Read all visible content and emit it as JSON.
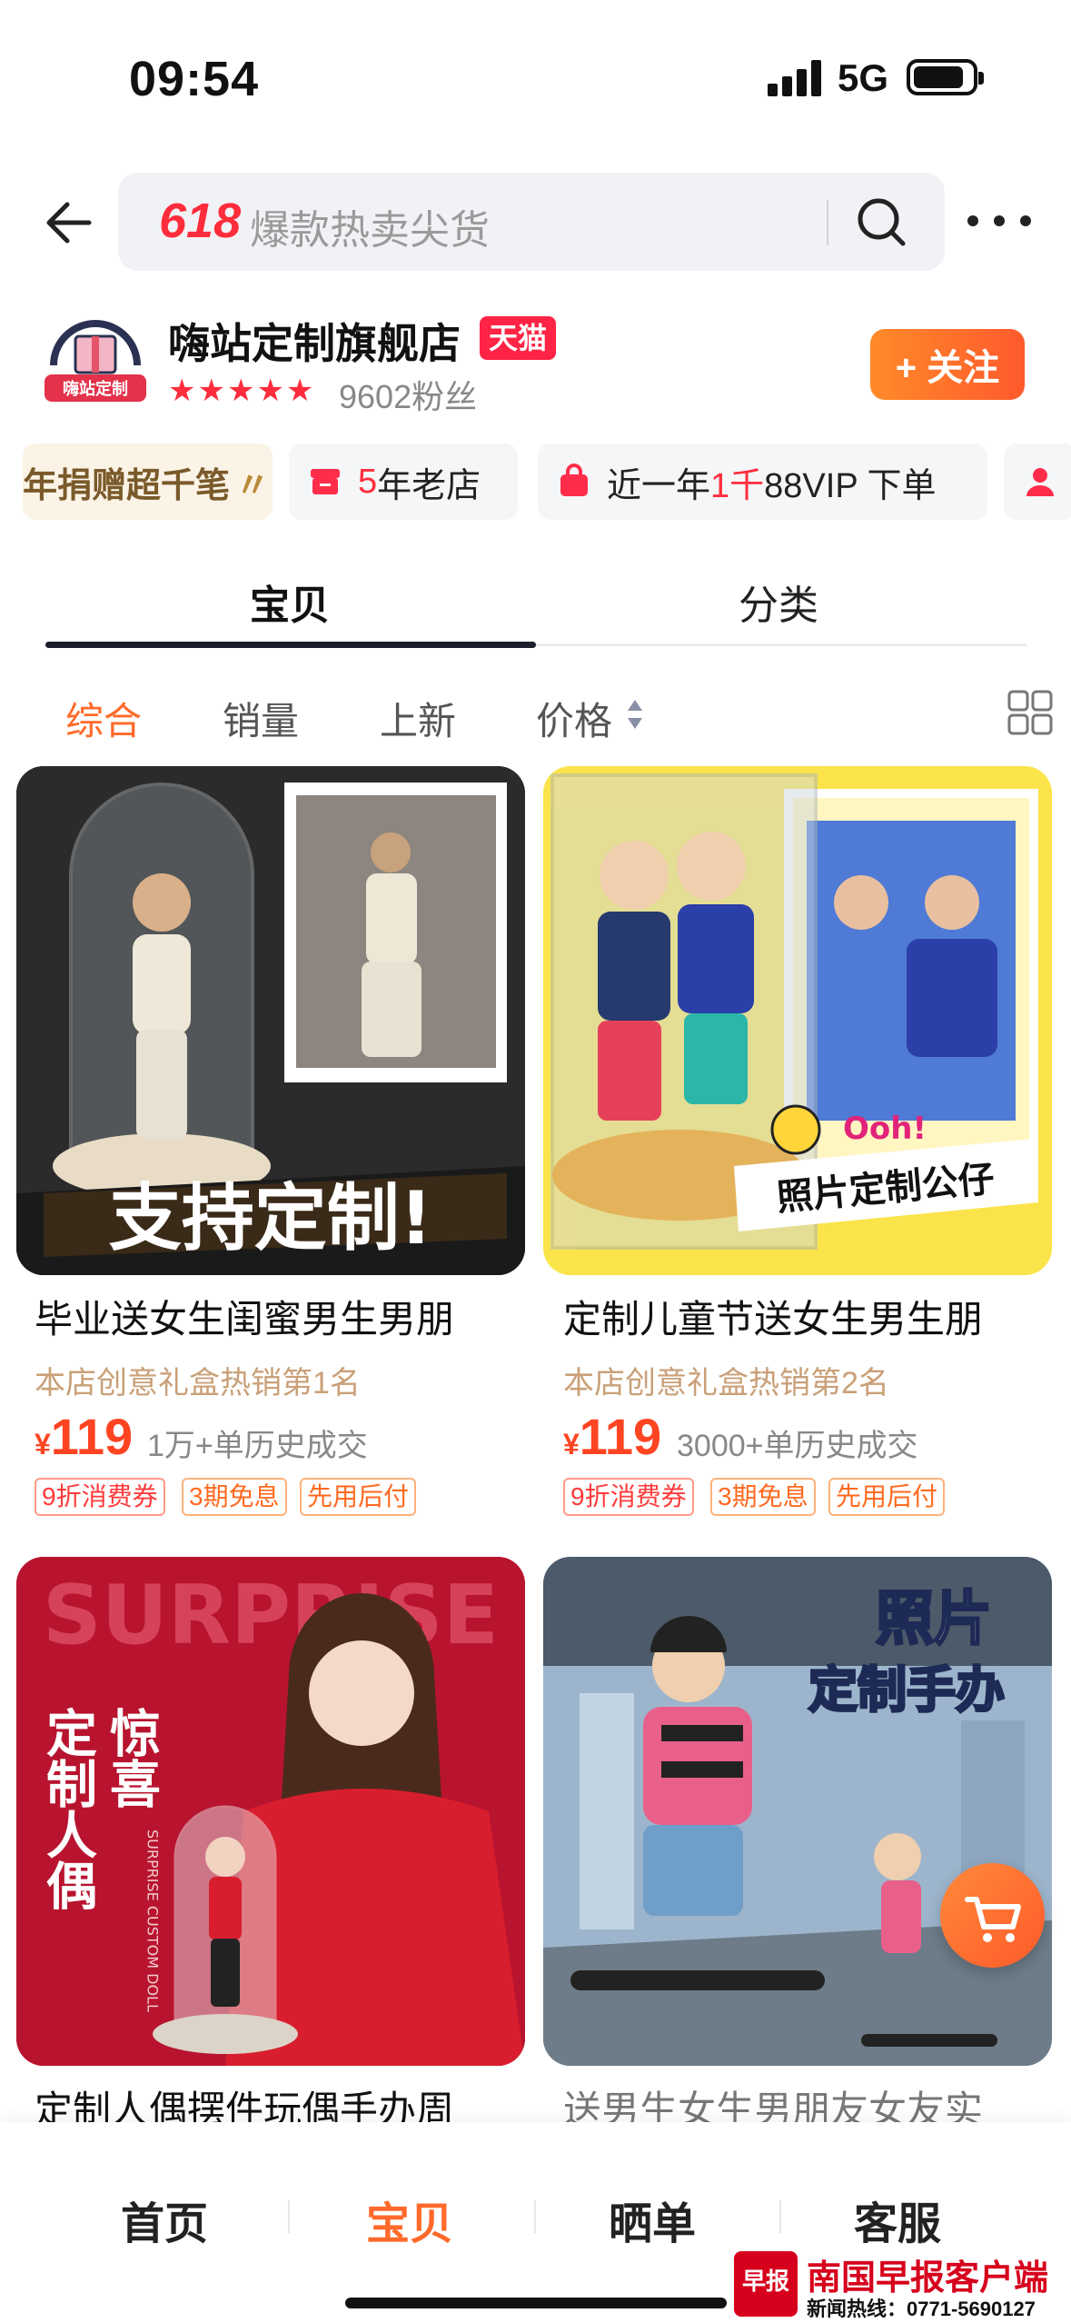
{
  "status_bar": {
    "time": "09:54",
    "network": "5G"
  },
  "search": {
    "promo_label": "618",
    "query_text": "爆款热卖尖货"
  },
  "store": {
    "logo_text": "嗨站定制",
    "name": "嗨站定制旗舰店",
    "badge": "天猫",
    "rating_stars": "★★★★★",
    "fans": "9602粉丝",
    "follow_label": "+ 关注"
  },
  "chips": [
    {
      "text": "年捐赠超千笔"
    },
    {
      "pre": "",
      "highlight": "5",
      "post": "年老店"
    },
    {
      "pre": "近一年",
      "highlight": "1千",
      "post": "88VIP 下单"
    }
  ],
  "tabs": [
    {
      "label": "宝贝"
    },
    {
      "label": "分类"
    }
  ],
  "sort": [
    {
      "label": "综合"
    },
    {
      "label": "销量"
    },
    {
      "label": "上新"
    },
    {
      "label": "价格"
    }
  ],
  "products": [
    {
      "image_caption": "支持定制!",
      "title": "毕业送女生闺蜜男生男朋",
      "rank": "本店创意礼盒热销第1名",
      "currency": "¥",
      "price": "119",
      "sold": "1万+单历史成交",
      "tags": [
        "9折消费券",
        "3期免息",
        "先用后付"
      ]
    },
    {
      "image_caption": "照片定制公仔",
      "image_badge": "Ooh!",
      "title": "定制儿童节送女生男生朋",
      "rank": "本店创意礼盒热销第2名",
      "currency": "¥",
      "price": "119",
      "sold": "3000+单历史成交",
      "tags": [
        "9折消费券",
        "3期免息",
        "先用后付"
      ]
    },
    {
      "image_caption_bg": "SURPRISE",
      "image_caption": "定制人偶",
      "image_caption2": "惊喜",
      "image_caption_small": "SURPRISE CUSTOM DOLL",
      "title": "定制人偶摆件玩偶手办周"
    },
    {
      "image_caption": "照片",
      "image_caption2": "定制手办",
      "title": "送男生女生男朋友女友实"
    }
  ],
  "bottom_nav": [
    {
      "label": "首页"
    },
    {
      "label": "宝贝"
    },
    {
      "label": "晒单"
    },
    {
      "label": "客服"
    }
  ],
  "watermark": {
    "logo": "早报",
    "name": "南国早报客户端",
    "hotline": "新闻热线：0771-5690127"
  },
  "colors": {
    "accent": "#ff6a2a",
    "price": "#ff4422",
    "tmall": "#ff2445"
  }
}
